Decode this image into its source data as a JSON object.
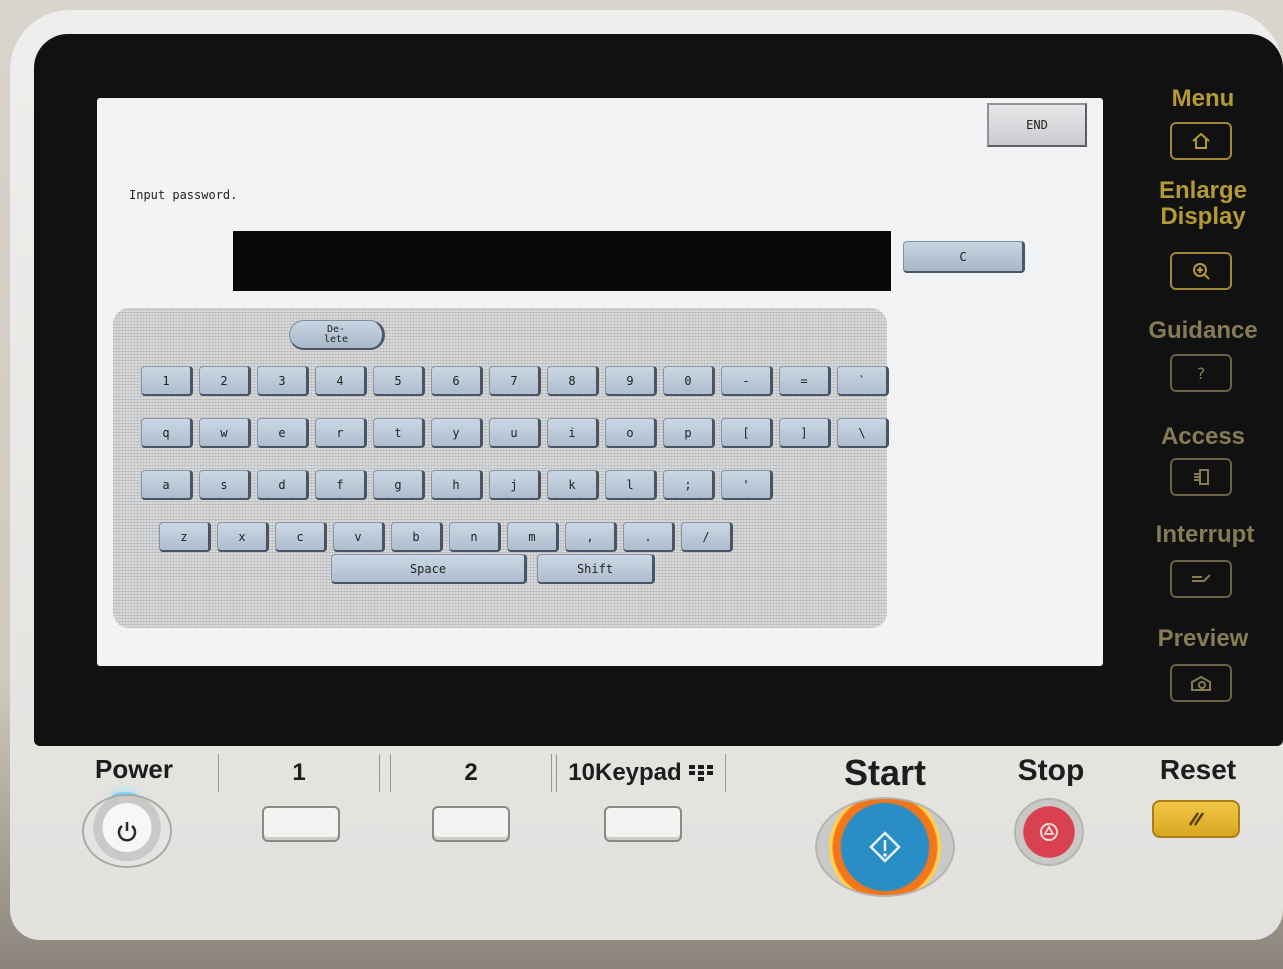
{
  "screen": {
    "end_label": "END",
    "prompt": "Input password.",
    "clear_label": "C",
    "delete_label": "De-\nlete",
    "rows": [
      [
        "1",
        "2",
        "3",
        "4",
        "5",
        "6",
        "7",
        "8",
        "9",
        "0",
        "-",
        "=",
        "`"
      ],
      [
        "q",
        "w",
        "e",
        "r",
        "t",
        "y",
        "u",
        "i",
        "o",
        "p",
        "[",
        "]",
        "\\"
      ],
      [
        "a",
        "s",
        "d",
        "f",
        "g",
        "h",
        "j",
        "k",
        "l",
        ";",
        "'"
      ],
      [
        "z",
        "x",
        "c",
        "v",
        "b",
        "n",
        "m",
        ",",
        ".",
        "/"
      ]
    ],
    "space_label": "Space",
    "shift_label": "Shift"
  },
  "side_panel": {
    "menu": "Menu",
    "enlarge": "Enlarge Display",
    "guidance": "Guidance",
    "access": "Access",
    "interrupt": "Interrupt",
    "preview": "Preview",
    "guidance_icon": "?"
  },
  "bottom": {
    "power": "Power",
    "tab1": "1",
    "tab2": "2",
    "tab3": "10Keypad",
    "start": "Start",
    "stop": "Stop",
    "reset": "Reset"
  }
}
